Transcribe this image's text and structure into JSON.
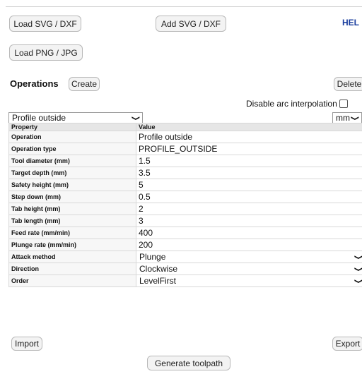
{
  "toolbar": {
    "load_svg_label": "Load SVG / DXF",
    "add_svg_label": "Add SVG / DXF",
    "help_label": "HEL",
    "load_png_label": "Load PNG / JPG"
  },
  "operations": {
    "title": "Operations",
    "create_label": "Create",
    "delete_label": "Delete",
    "disable_arc_label": "Disable arc interpolation",
    "selected_operation": "Profile outside",
    "units": "mm"
  },
  "table": {
    "header": {
      "property": "Property",
      "value": "Value"
    },
    "rows": [
      {
        "property": "Operation",
        "value": "Profile outside"
      },
      {
        "property": "Operation type",
        "value": "PROFILE_OUTSIDE"
      },
      {
        "property": "Tool diameter (mm)",
        "value": "1.5"
      },
      {
        "property": "Target depth (mm)",
        "value": "3.5"
      },
      {
        "property": "Safety height (mm)",
        "value": "5"
      },
      {
        "property": "Step down (mm)",
        "value": "0.5"
      },
      {
        "property": "Tab height (mm)",
        "value": "2"
      },
      {
        "property": "Tab length (mm)",
        "value": "3"
      },
      {
        "property": "Feed rate (mm/min)",
        "value": "400"
      },
      {
        "property": "Plunge rate (mm/min)",
        "value": "200"
      },
      {
        "property": "Attack method",
        "value": "Plunge"
      },
      {
        "property": "Direction",
        "value": "Clockwise"
      },
      {
        "property": "Order",
        "value": "LevelFirst"
      }
    ]
  },
  "footer": {
    "import_label": "Import",
    "export_label": "Export",
    "generate_label": "Generate toolpath"
  }
}
